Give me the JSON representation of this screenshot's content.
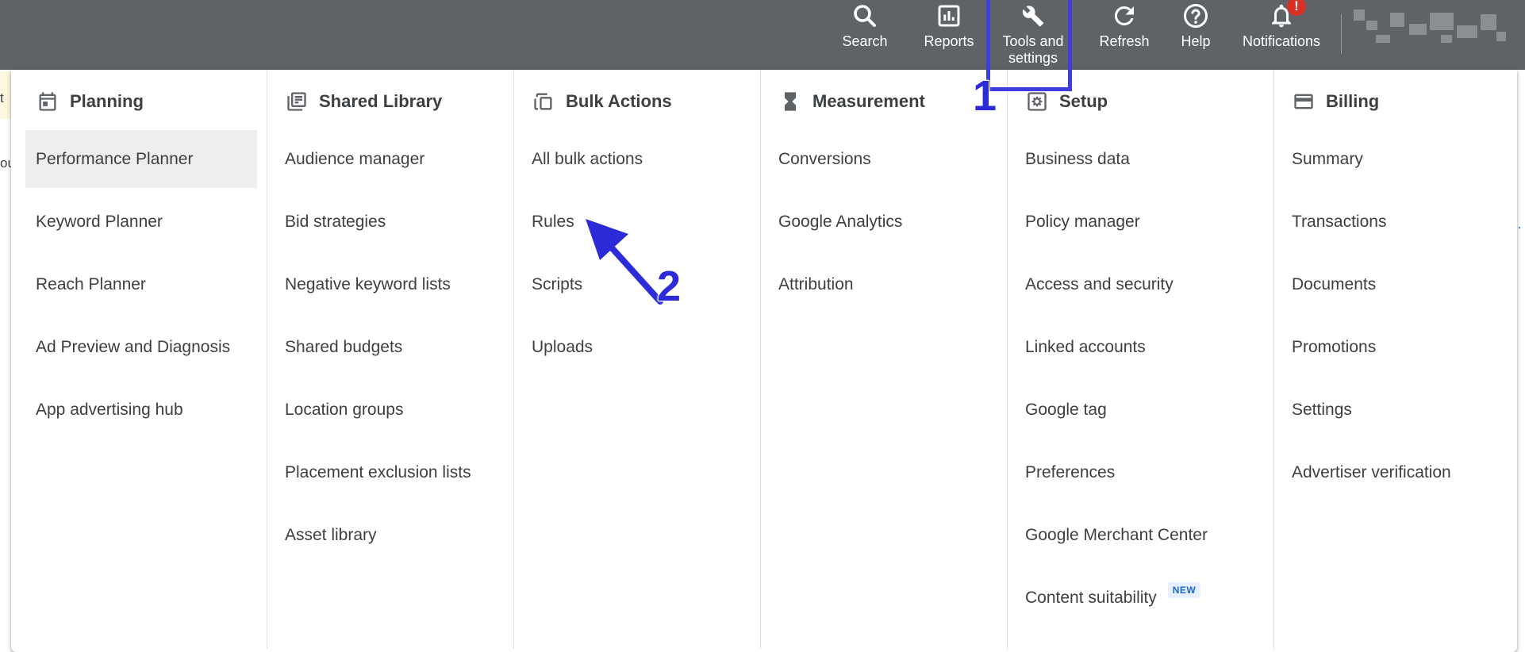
{
  "toolbar": {
    "search": "Search",
    "reports": "Reports",
    "tools_line1": "Tools and",
    "tools_line2": "settings",
    "refresh": "Refresh",
    "help": "Help",
    "notifications": "Notifications",
    "notification_badge": "!"
  },
  "background": {
    "frag1": "t",
    "frag2": "ou"
  },
  "menu": {
    "planning": {
      "title": "Planning",
      "items": [
        "Performance Planner",
        "Keyword Planner",
        "Reach Planner",
        "Ad Preview and Diagnosis",
        "App advertising hub"
      ]
    },
    "shared_library": {
      "title": "Shared Library",
      "items": [
        "Audience manager",
        "Bid strategies",
        "Negative keyword lists",
        "Shared budgets",
        "Location groups",
        "Placement exclusion lists",
        "Asset library"
      ]
    },
    "bulk_actions": {
      "title": "Bulk Actions",
      "items": [
        "All bulk actions",
        "Rules",
        "Scripts",
        "Uploads"
      ]
    },
    "measurement": {
      "title": "Measurement",
      "items": [
        "Conversions",
        "Google Analytics",
        "Attribution"
      ]
    },
    "setup": {
      "title": "Setup",
      "items": [
        "Business data",
        "Policy manager",
        "Access and security",
        "Linked accounts",
        "Google tag",
        "Preferences",
        "Google Merchant Center",
        "Content suitability"
      ],
      "new_badge": "NEW"
    },
    "billing": {
      "title": "Billing",
      "items": [
        "Summary",
        "Transactions",
        "Documents",
        "Promotions",
        "Settings",
        "Advertiser verification"
      ]
    }
  },
  "annotations": {
    "step1": "1",
    "step2": "2"
  },
  "colors": {
    "topbar": "#5f6368",
    "annotation": "#2b2bd8",
    "badge": "#d93025"
  }
}
